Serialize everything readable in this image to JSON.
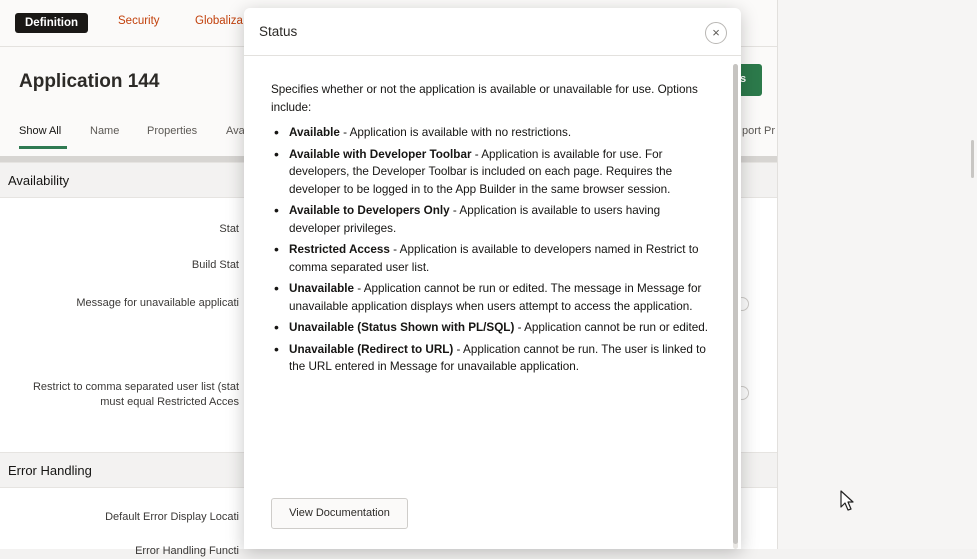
{
  "tabs": {
    "definition": "Definition",
    "security": "Security",
    "globalization": "Globaliza"
  },
  "app": {
    "title": "Application 144",
    "right_button": "s"
  },
  "subnav": {
    "show_all": "Show All",
    "name": "Name",
    "properties": "Properties",
    "ava": "Ava",
    "report": "port Pr"
  },
  "sections": {
    "availability": "Availability",
    "error_handling": "Error Handling"
  },
  "fields": {
    "status": "Stat",
    "build_status": "Build Stat",
    "message_unavailable": "Message for unavailable applicati",
    "restrict_line1": "Restrict to comma separated user list (stat",
    "restrict_line2": "must equal Restricted Acces",
    "default_error": "Default Error Display Locati",
    "error_function": "Error Handling Functi"
  },
  "dialog": {
    "title": "Status",
    "close_label": "×",
    "intro": "Specifies whether or not the application is available or unavailable for use. Options include:",
    "options": [
      {
        "term": "Available",
        "desc": " - Application is available with no restrictions."
      },
      {
        "term": "Available with Developer Toolbar",
        "desc": " - Application is available for use. For developers, the Developer Toolbar is included on each page. Requires the developer to be logged in to the App Builder in the same browser session."
      },
      {
        "term": "Available to Developers Only",
        "desc": " - Application is available to users having developer privileges."
      },
      {
        "term": "Restricted Access",
        "desc": " - Application is available to developers named in Restrict to comma separated user list."
      },
      {
        "term": "Unavailable",
        "desc": " - Application cannot be run or edited. The message in Message for unavailable application displays when users attempt to access the application."
      },
      {
        "term": "Unavailable (Status Shown with PL/SQL)",
        "desc": " - Application cannot be run or edited."
      },
      {
        "term": "Unavailable (Redirect to URL)",
        "desc": " - Application cannot be run. The user is linked to the URL entered in Message for unavailable application."
      }
    ],
    "doc_button": "View Documentation"
  },
  "colors": {
    "accent_green": "#2c7a4b",
    "link_orange": "#c2410c"
  }
}
